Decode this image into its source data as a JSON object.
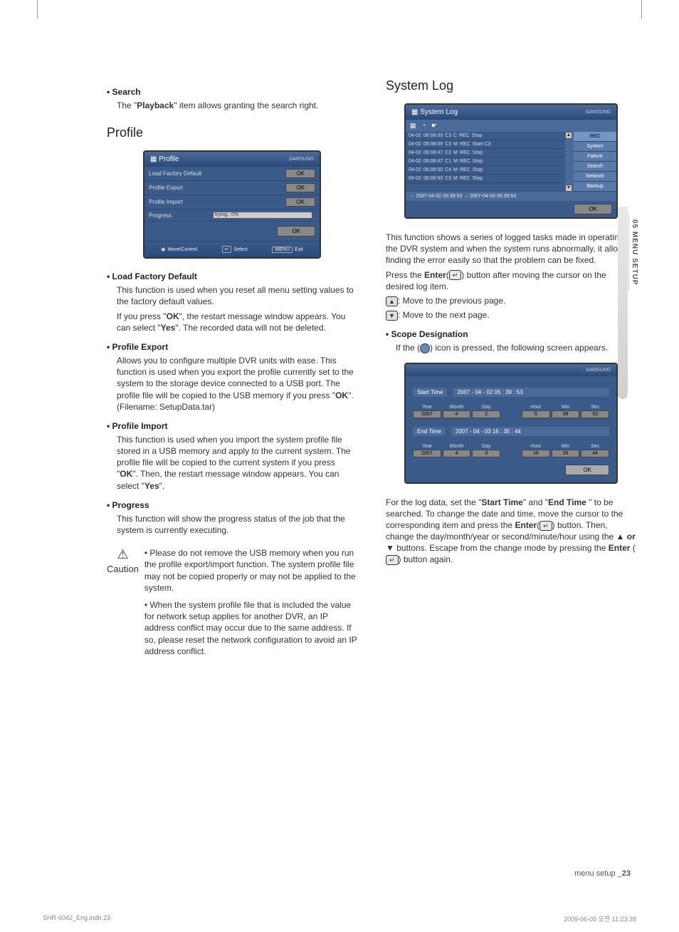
{
  "sideTab": "05 MENU SETUP",
  "left": {
    "search": {
      "head": "Search",
      "body_pre": "The \"",
      "body_bold": "Playback",
      "body_post": "\" item allows granting the search right."
    },
    "profile_heading": "Profile",
    "ui": {
      "title": "Profile",
      "brand": "SAMSUNG",
      "rows": {
        "lfd": "Load Factory Default",
        "pe": "Profile Export",
        "pi": "Profile Import",
        "prog": "Progress",
        "progress_text": "trying.. 0%"
      },
      "ok": "OK",
      "footer": {
        "move": "Move/Control",
        "select": "Select",
        "exit": "Exit",
        "menu_key": "MENU",
        "enter_key": "↵"
      }
    },
    "lfd": {
      "head": "Load Factory Default",
      "p1": "This function is used when you reset all menu setting values to the factory default values.",
      "p2a": "If you press \"",
      "p2b": "OK",
      "p2c": "\", the restart message window appears. You can select \"",
      "p2d": "Yes",
      "p2e": "\". The recorded data will not be deleted."
    },
    "pe": {
      "head": "Profile Export",
      "p1a": "Allows you to configure multiple DVR units with ease. This function is used when you export the profile currently set to the system to the storage device connected to a USB port. The profile file will be copied to the USB memory if you press \"",
      "p1b": "OK",
      "p1c": "\". (Filename: SetupData.tar)"
    },
    "pi": {
      "head": "Profile Import",
      "p1a": "This function is used when you import the system profile file stored in a USB memory and apply to the current system. The profile file will be copied to the current system if you press \"",
      "p1b": "OK",
      "p1c": "\". Then, the restart message window appears. You can select \"",
      "p1d": "Yes",
      "p1e": "\"."
    },
    "prog": {
      "head": "Progress",
      "p": "This function will show the progress status of the job that the system is currently executing."
    },
    "caution": {
      "label": "Caution",
      "li1": "Please do not remove the USB memory when you run the profile export/import function. The system profile file may not be copied properly or may not be applied to the system.",
      "li2": "When the system profile file that is included the value for network setup applies for another DVR, an IP address conflict may occur due to the same address. If so, please reset the network configuration to avoid an IP address conflict."
    }
  },
  "right": {
    "heading": "System Log",
    "ui": {
      "title": "System Log",
      "brand": "SAMSUNG",
      "icons": [
        "▦",
        "◔",
        "☛"
      ],
      "rows": [
        [
          "04-02",
          "06:08:09",
          "C3",
          "C",
          "REC",
          "Stop"
        ],
        [
          "04-02",
          "06:08:09",
          "C3",
          "M",
          "REC",
          "Start C3"
        ],
        [
          "04-02",
          "06:08:47",
          "C2",
          "M",
          "REC",
          "Stop"
        ],
        [
          "04-02",
          "06:08:47",
          "C1",
          "M",
          "REC",
          "Stop"
        ],
        [
          "04-02",
          "06:08:50",
          "C4",
          "M",
          "REC",
          "Stop"
        ],
        [
          "04-02",
          "06:08:50",
          "C3",
          "M",
          "REC",
          "Stop"
        ]
      ],
      "side": [
        "REC",
        "System",
        "Failure",
        "Search",
        "Network",
        "Backup"
      ],
      "timerange": "2007-04-02 05:39:53 → 2007-04-03 05:39:53",
      "ok": "OK"
    },
    "p1": "This function shows a series of logged tasks made in operating the DVR system and when the system runs abnormally, it allows finding the error easily so that the problem can be fixed.",
    "p2a": "Press the ",
    "p2b": "Enter",
    "p2c": " button after moving the cursor on the desired log item.",
    "p3": ": Move to the previous page.",
    "p4": ": Move to the next page.",
    "scope": {
      "head": "Scope Designation",
      "p1a": "If the ",
      "p1b": " icon is pressed, the following screen appears."
    },
    "scopeUi": {
      "brand": "SAMSUNG",
      "start": {
        "label": "Start Time",
        "value": "2007 - 04 - 02    05 : 39 : 53"
      },
      "end": {
        "label": "End Time",
        "value": "2007 - 04 - 03    16 : 35 : 44"
      },
      "heads_date": [
        "Year",
        "Month",
        "Day"
      ],
      "heads_time": [
        "Hour",
        "Min",
        "Sec"
      ],
      "start_date": [
        "2007",
        "4",
        "2"
      ],
      "start_time": [
        "5",
        "39",
        "53"
      ],
      "end_date": [
        "2007",
        "4",
        "3"
      ],
      "end_time": [
        "16",
        "35",
        "44"
      ],
      "ok": "OK"
    },
    "p5a": "For the log data, set the \"",
    "p5b": "Start Time",
    "p5c": "\" and \"",
    "p5d": "End Time",
    "p5e": " \" to be searched. To change the date and time, move the cursor to the corresponding item and press the ",
    "p5f": "Enter",
    "p5g": " button. Then, change the day/month/year or second/minute/hour using the ",
    "p5h": "▲ or ▼",
    "p5i": " buttons. Escape from the change mode by pressing the ",
    "p5j": "Enter",
    "p5k": " button again."
  },
  "footer": {
    "text": "menu setup _",
    "page": "23"
  },
  "print": {
    "left": "SHR-6042_Eng.indb   23",
    "right": "2009-06-05   오전 11:23:38"
  }
}
